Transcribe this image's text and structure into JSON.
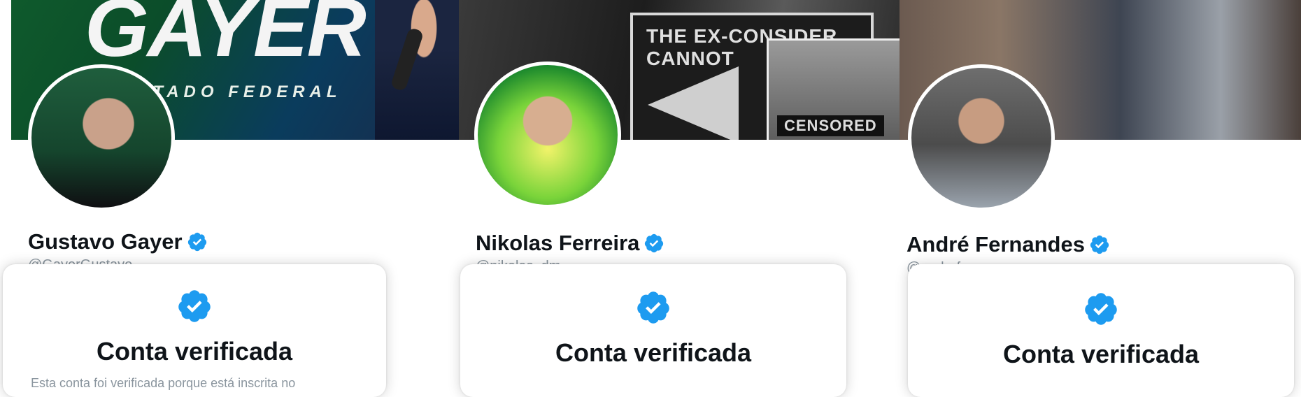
{
  "profiles": [
    {
      "name": "Gustavo Gayer",
      "handle": "@GayerGustavo",
      "banner_big_text": "GAYER",
      "banner_small_text": "UTADO FEDERAL",
      "popup_title": "Conta verificada",
      "popup_sub": "Esta conta foi verificada porque está inscrita no"
    },
    {
      "name": "Nikolas Ferreira",
      "handle": "@nikolas_dm",
      "banner_sign_text": "THE EX-CONSIDER CANNOT",
      "banner_censored": "CENSORED",
      "popup_title": "Conta verificada"
    },
    {
      "name": "André Fernandes",
      "handle": "@andrefer",
      "popup_title": "Conta verificada"
    }
  ],
  "colors": {
    "verified_blue": "#1d9bf0",
    "text_primary": "#0f1419",
    "text_secondary": "#8a959e"
  },
  "icons": {
    "verified": "verified-badge-icon"
  }
}
